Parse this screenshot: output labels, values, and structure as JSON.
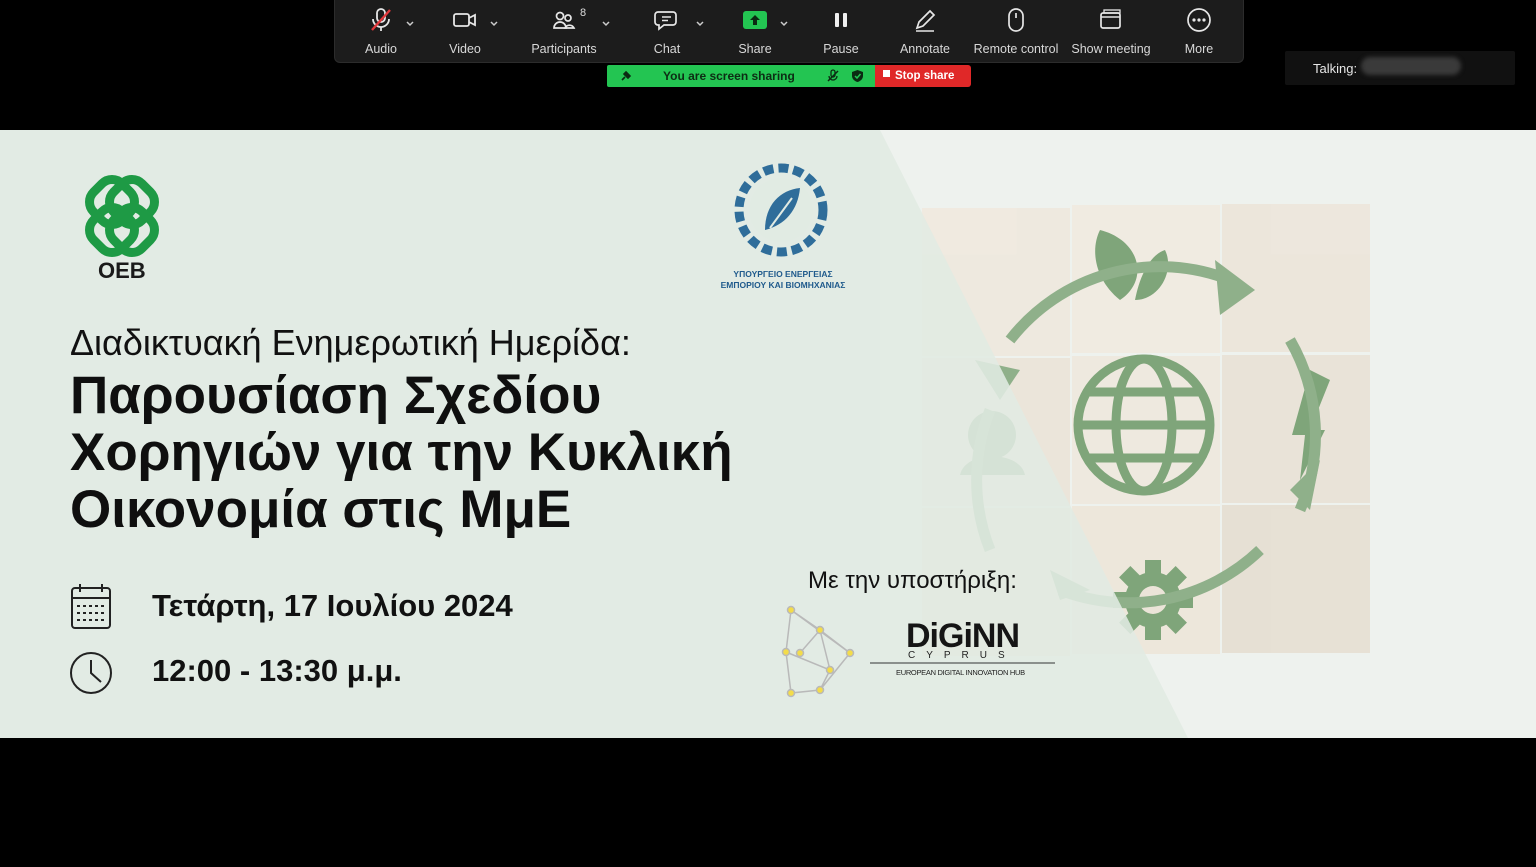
{
  "toolbar": {
    "audio": "Audio",
    "video": "Video",
    "participants": "Participants",
    "participants_count": "8",
    "chat": "Chat",
    "share": "Share",
    "pause": "Pause",
    "annotate": "Annotate",
    "remote_control": "Remote control",
    "show_meeting": "Show meeting",
    "more": "More"
  },
  "share_bar": {
    "status": "You are screen sharing",
    "stop": "Stop share"
  },
  "talking": {
    "label": "Talking:"
  },
  "slide": {
    "logo_left": "OEB",
    "ministry_line1": "ΥΠΟΥΡΓΕΙΟ ΕΝΕΡΓΕΙΑΣ",
    "ministry_line2": "ΕΜΠΟΡΙΟΥ ΚΑΙ ΒΙΟΜΗΧΑΝΙΑΣ",
    "subtitle": "Διαδικτυακή Ενημερωτική Ημερίδα:",
    "title_line1": "Παρουσίαση Σχεδίου",
    "title_line2": "Χορηγιών για την Κυκλική",
    "title_line3": "Οικονομία στις ΜμΕ",
    "date": "Τετάρτη, 17 Ιουλίου 2024",
    "time": "12:00 - 13:30 μ.μ.",
    "support": "Με την υποστήριξη:",
    "diginn": "DiGiNN",
    "diginn_sub": "CYPRUS",
    "diginn_hub": "EUROPEAN DIGITAL INNOVATION HUB"
  },
  "colors": {
    "toolbar_bg": "#1c1c1c",
    "share_green": "#23c552",
    "stop_red": "#e02828",
    "slide_bg": "#e6ede8",
    "oeb_green": "#1e9a45",
    "ministry_blue": "#1f5a8c",
    "art_green": "#7fa57a"
  }
}
